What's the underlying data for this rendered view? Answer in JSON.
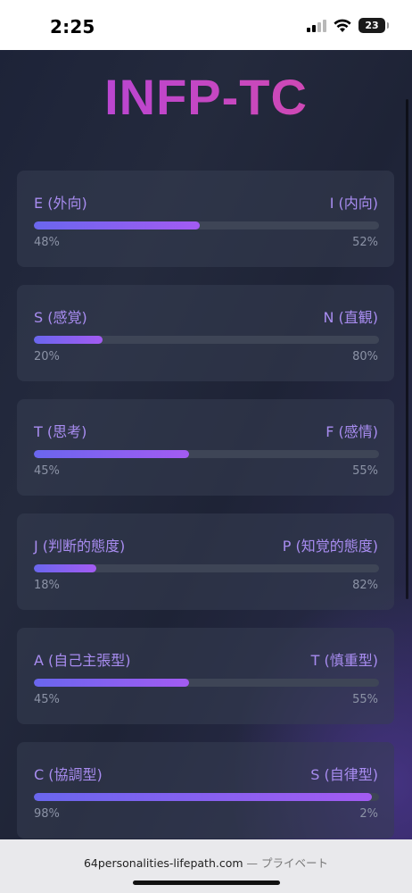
{
  "status_bar": {
    "time": "2:25",
    "battery": "23"
  },
  "title": "INFP-TC",
  "dimensions": [
    {
      "left": "E (外向)",
      "right": "I (内向)",
      "left_pct": "48%",
      "right_pct": "52%",
      "value": 48
    },
    {
      "left": "S (感覚)",
      "right": "N (直観)",
      "left_pct": "20%",
      "right_pct": "80%",
      "value": 20
    },
    {
      "left": "T (思考)",
      "right": "F (感情)",
      "left_pct": "45%",
      "right_pct": "55%",
      "value": 45
    },
    {
      "left": "J (判断的態度)",
      "right": "P (知覚的態度)",
      "left_pct": "18%",
      "right_pct": "82%",
      "value": 18
    },
    {
      "left": "A (自己主張型)",
      "right": "T (慎重型)",
      "left_pct": "45%",
      "right_pct": "55%",
      "value": 45
    },
    {
      "left": "C (協調型)",
      "right": "S (自律型)",
      "left_pct": "98%",
      "right_pct": "2%",
      "value": 98
    }
  ],
  "url_bar": {
    "domain": "64personalities-lifepath.com",
    "separator": " — ",
    "mode": "プライベート"
  },
  "colors": {
    "title_start": "#b044e0",
    "title_end": "#d84aa6",
    "bar_start": "#6a66ee",
    "bar_end": "#a35bf2",
    "label": "#a88cf0"
  },
  "icons": [
    "signal-icon",
    "wifi-icon",
    "battery-icon"
  ]
}
